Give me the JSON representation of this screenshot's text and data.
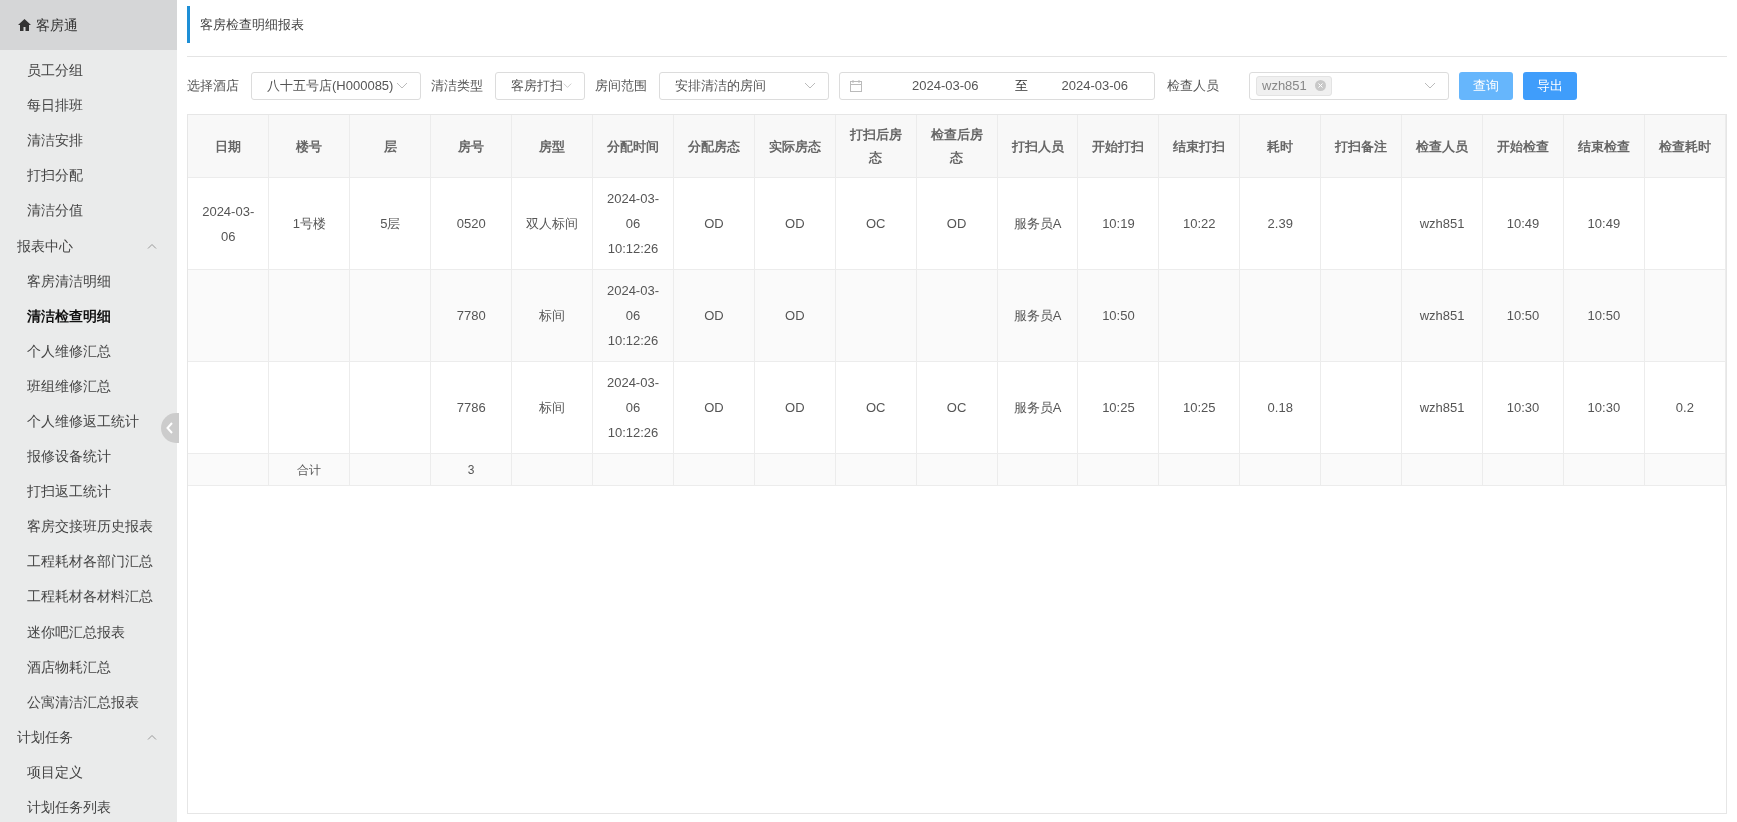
{
  "sidebar": {
    "title": "客房通",
    "items": [
      {
        "label": "员工分组",
        "selected": false
      },
      {
        "label": "每日排班",
        "selected": false
      },
      {
        "label": "清洁安排",
        "selected": false
      },
      {
        "label": "打扫分配",
        "selected": false
      },
      {
        "label": "清洁分值",
        "selected": false
      },
      {
        "label": "报表中心",
        "expanded": true,
        "children": [
          {
            "label": "客房清洁明细",
            "selected": false
          },
          {
            "label": "清洁检查明细",
            "selected": true
          },
          {
            "label": "个人维修汇总",
            "selected": false
          },
          {
            "label": "班组维修汇总",
            "selected": false
          },
          {
            "label": "个人维修返工统计",
            "selected": false
          },
          {
            "label": "报修设备统计",
            "selected": false
          },
          {
            "label": "打扫返工统计",
            "selected": false
          },
          {
            "label": "客房交接班历史报表",
            "selected": false
          },
          {
            "label": "工程耗材各部门汇总",
            "selected": false
          },
          {
            "label": "工程耗材各材料汇总",
            "selected": false
          },
          {
            "label": "迷你吧汇总报表",
            "selected": false
          },
          {
            "label": "酒店物耗汇总",
            "selected": false
          },
          {
            "label": "公寓清洁汇总报表",
            "selected": false
          }
        ]
      },
      {
        "label": "计划任务",
        "expanded": true,
        "children": [
          {
            "label": "项目定义",
            "selected": false
          },
          {
            "label": "计划任务列表",
            "selected": false
          }
        ]
      }
    ]
  },
  "page_title": "客房检查明细报表",
  "filters": [
    {
      "kind": "select",
      "label": "选择酒店",
      "value": "八十五号店(H000085)"
    },
    {
      "kind": "select",
      "label": "清洁类型",
      "value": "客房打扫"
    },
    {
      "kind": "select",
      "label": "房间范围",
      "value": "安排清洁的房间"
    },
    {
      "kind": "daterange",
      "start": "2024-03-06",
      "separator": "至",
      "end": "2024-03-06"
    },
    {
      "kind": "tags",
      "label": "检查人员",
      "tags": [
        "wzh851"
      ]
    }
  ],
  "buttons": [
    {
      "label": "查询",
      "disabled": true
    },
    {
      "label": "导出",
      "disabled": false
    }
  ],
  "table": {
    "columns": [
      "日期",
      "楼号",
      "层",
      "房号",
      "房型",
      "分配时间",
      "分配房态",
      "实际房态",
      "打扫后房态",
      "检查后房态",
      "打扫人员",
      "开始打扫",
      "结束打扫",
      "耗时",
      "打扫备注",
      "检查人员",
      "开始检查",
      "结束检查",
      "检查耗时"
    ],
    "rows": [
      {
        "date": "2024-03-06",
        "building": "1号楼",
        "floor": "5层",
        "room": "0520",
        "room_type": "双人标间",
        "assign_time": "2024-03-06 10:12:26",
        "assigned_status": "OD",
        "actual_status": "OD",
        "status_after_clean": "OC",
        "status_after_check": "OD",
        "cleaner": "服务员A",
        "clean_start": "10:19",
        "clean_end": "10:22",
        "duration": "2.39",
        "inspector": "wzh851",
        "check_start": "10:49",
        "check_end": "10:49"
      },
      {
        "room": "7780",
        "room_type": "标间",
        "assign_time": "2024-03-06 10:12:26",
        "assigned_status": "OD",
        "actual_status": "OD",
        "cleaner": "服务员A",
        "clean_start": "10:50",
        "inspector": "wzh851",
        "check_start": "10:50",
        "check_end": "10:50"
      },
      {
        "room": "7786",
        "room_type": "标间",
        "assign_time": "2024-03-06 10:12:26",
        "assigned_status": "OD",
        "actual_status": "OD",
        "status_after_clean": "OC",
        "status_after_check": "OC",
        "cleaner": "服务员A",
        "clean_start": "10:25",
        "clean_end": "10:25",
        "duration": "0.18",
        "inspector": "wzh851",
        "check_start": "10:30",
        "check_end": "10:30",
        "check_duration": "0.2"
      }
    ],
    "total_row": {
      "building": "合计",
      "room": "3"
    }
  }
}
